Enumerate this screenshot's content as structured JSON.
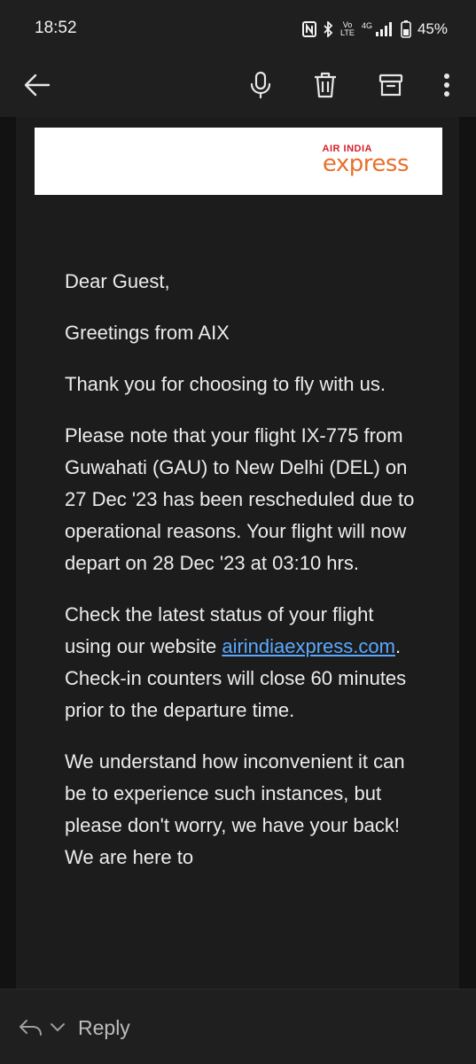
{
  "status_bar": {
    "time": "18:52",
    "battery": "45%",
    "network": "4G",
    "volte": "Vo LTE"
  },
  "toolbar": {
    "back_icon": "arrow-left-icon",
    "mic_icon": "microphone-icon",
    "delete_icon": "trash-icon",
    "archive_icon": "archive-icon",
    "more_icon": "more-vertical-icon"
  },
  "email": {
    "logo": {
      "line1": "AIR INDIA",
      "line2": "express"
    },
    "greeting": "Dear Guest,",
    "line_greetings": "Greetings from AIX",
    "thanks": "Thank you for choosing to fly with us.",
    "notice": "Please note that your flight IX-775 from Guwahati (GAU) to New Delhi (DEL) on 27 Dec '23 has been rescheduled due to operational reasons. Your flight will now depart on 28 Dec '23 at 03:10 hrs.",
    "status_before_link": "Check the latest status of your flight using our website ",
    "status_link": "airindiaexpress.com",
    "status_after_link": ". Check-in counters will close 60 minutes prior to the departure time.",
    "understand": "We understand how inconvenient it can be to experience such instances, but please don't worry, we have your back! We are here to"
  },
  "bottom_bar": {
    "reply_label": "Reply"
  },
  "colors": {
    "background": "#121212",
    "toolbar": "#1f1f1f",
    "link": "#5aa9ff",
    "logo_red": "#d6202b",
    "logo_orange": "#e8702a"
  }
}
